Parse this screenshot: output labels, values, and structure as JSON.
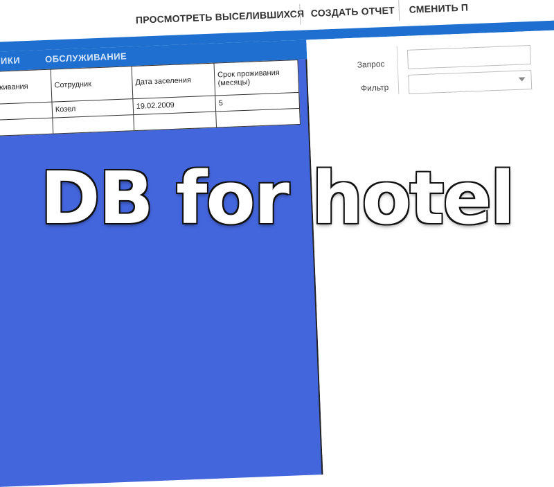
{
  "menu": {
    "view_checked_out": "ПРОСМОТРЕТЬ ВЫСЕЛИВШИХСЯ",
    "create_report": "СОЗДАТЬ ОТЧЕТ",
    "change": "СМЕНИТЬ П"
  },
  "tabs": [
    "НИКИ",
    "ОБСЛУЖИВАНИЕ"
  ],
  "table": {
    "headers": [
      "служивания",
      "Сотрудник",
      "Дата заселения",
      "Срок проживания (месяцы)"
    ],
    "rows": [
      [
        "",
        "Козел",
        "19.02.2009",
        "5"
      ],
      [
        "",
        "",
        "",
        ""
      ]
    ]
  },
  "filters": {
    "query_label": "Запрос",
    "filter_label": "Фильтр",
    "query_value": "",
    "filter_value": ""
  },
  "overlay_title": "DB for hotel",
  "colors": {
    "accent": "#1f6fd0",
    "grid_background": "#4466dd"
  }
}
